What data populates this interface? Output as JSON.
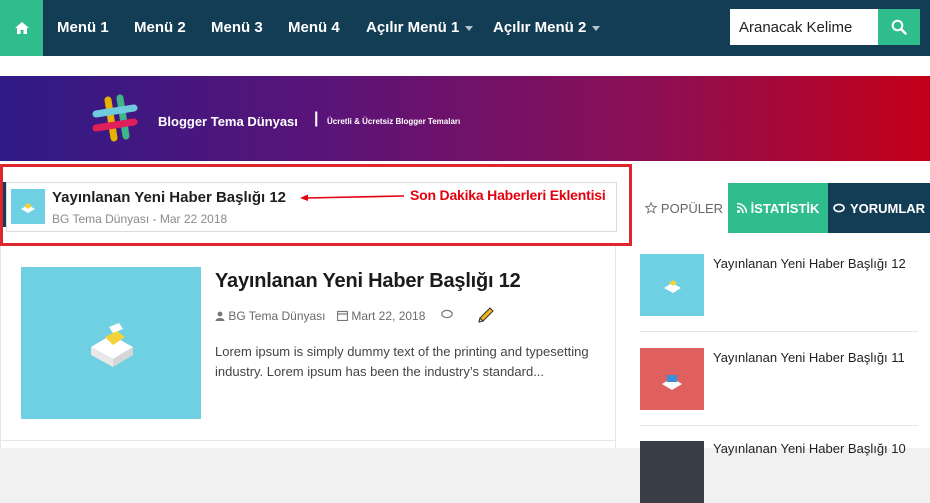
{
  "nav": {
    "items": [
      "Menü 1",
      "Menü 2",
      "Menü 3",
      "Menü 4"
    ],
    "dropdowns": [
      "Açılır Menü 1",
      "Açılır Menü 2"
    ],
    "search_value": "Aranacak Kelime",
    "home_icon": "home-icon",
    "search_icon": "search-icon",
    "colors": {
      "bar": "#123d55",
      "accent": "#2fbd8e"
    }
  },
  "banner": {
    "title": "Blogger Tema Dünyası",
    "separator": "|",
    "subtitle": "Ücretli & Ücretsiz Blogger Temaları"
  },
  "ticker": {
    "title": "Yayınlanan Yeni Haber Başlığı 12",
    "meta": "BG Tema Dünyası - Mar 22 2018",
    "annotation": "Son Dakika Haberleri Eklentisi",
    "highlight_color": "#e0262d"
  },
  "post": {
    "title": "Yayınlanan Yeni Haber Başlığı 12",
    "author": "BG Tema Dünyası",
    "date": "Mart 22, 2018",
    "excerpt": "Lorem ipsum is simply dummy text of the printing and typesetting industry. Lorem ipsum has been the industry’s standard..."
  },
  "sidebar": {
    "tabs": [
      "POPÜLER",
      "İSTATİSTİK",
      "YORUMLAR"
    ],
    "items": [
      {
        "title": "Yayınlanan Yeni Haber Başlığı 12",
        "thumb_color": "#6fd0e4"
      },
      {
        "title": "Yayınlanan Yeni Haber Başlığı 11",
        "thumb_color": "#e06060"
      },
      {
        "title": "Yayınlanan Yeni Haber Başlığı 10",
        "thumb_color": "#3a3f47"
      }
    ]
  }
}
